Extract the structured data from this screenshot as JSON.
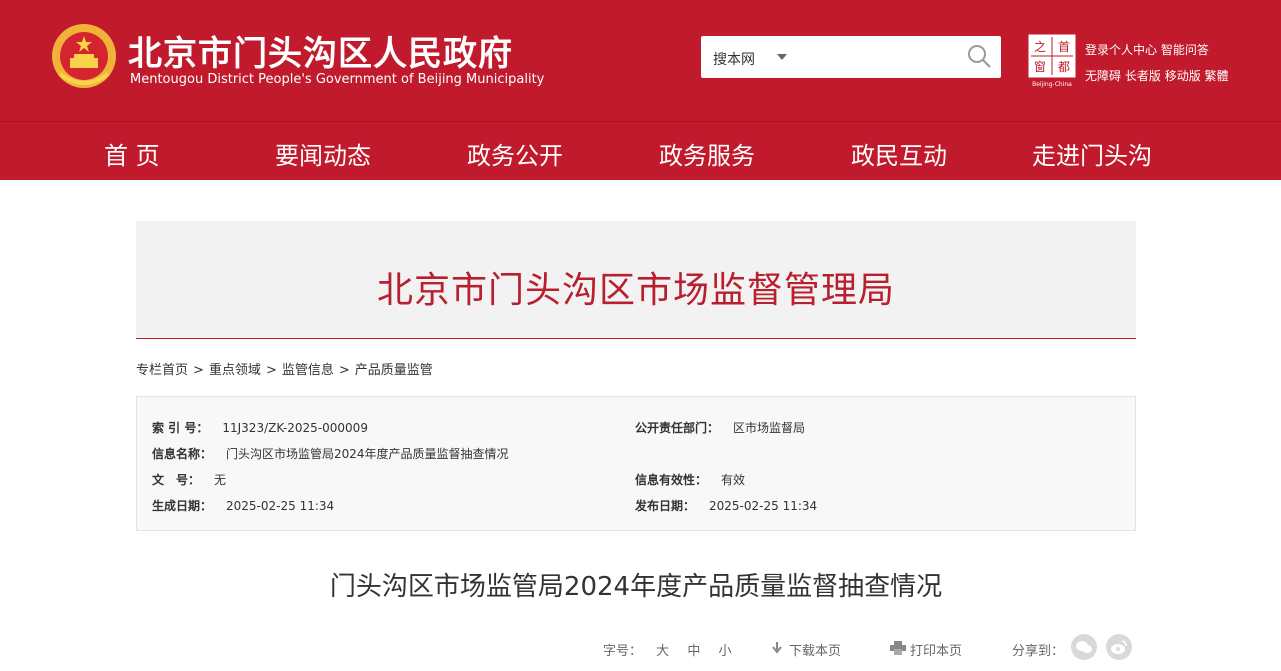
{
  "header": {
    "title": "北京市门头沟区人民政府",
    "subtitle": "Mentougou District People's Government of Beijing Municipality",
    "search": {
      "scope": "搜本网",
      "placeholder": ""
    },
    "capital_logo": {
      "text": "之首窗都",
      "caption": "Beijing-China"
    },
    "links_row1": [
      "登录个人中心",
      "智能问答"
    ],
    "links_row2": [
      "无障碍",
      "长者版",
      "移动版",
      "繁體"
    ],
    "brand_color": "#c01a2c"
  },
  "nav": [
    "首 页",
    "要闻动态",
    "政务公开",
    "政务服务",
    "政民互动",
    "走进门头沟"
  ],
  "banner": {
    "title": "北京市门头沟区市场监督管理局"
  },
  "breadcrumb": [
    "专栏首页",
    "重点领域",
    "监管信息",
    "产品质量监管"
  ],
  "breadcrumb_sep": ">",
  "info": {
    "index_label": "索 引 号：",
    "index_value": "11J323/ZK-2025-000009",
    "dept_label": "公开责任部门：",
    "dept_value": "区市场监督局",
    "name_label": "信息名称：",
    "name_value": "门头沟区市场监管局2024年度产品质量监督抽查情况",
    "docno_label": "文　号：",
    "docno_value": "无",
    "validity_label": "信息有效性：",
    "validity_value": "有效",
    "created_label": "生成日期：",
    "created_value": "2025-02-25 11:34",
    "published_label": "发布日期：",
    "published_value": "2025-02-25 11:34"
  },
  "article": {
    "title": "门头沟区市场监管局2024年度产品质量监督抽查情况"
  },
  "tools": {
    "font_label": "字号：",
    "font_big": "大",
    "font_mid": "中",
    "font_small": "小",
    "download": "下载本页",
    "print": "打印本页",
    "share_label": "分享到："
  }
}
